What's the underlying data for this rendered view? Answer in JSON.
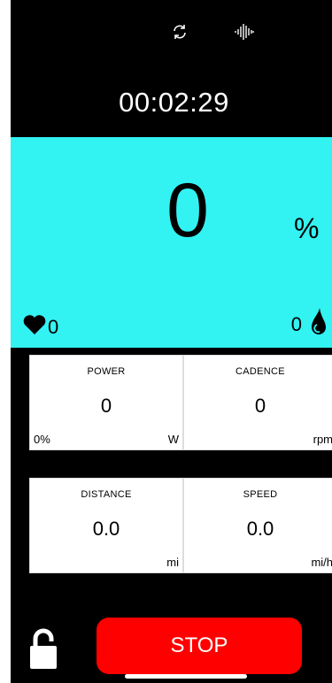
{
  "icons": {
    "sync": "sync-icon",
    "audio": "audio-wave-icon",
    "heart": "heart-icon",
    "drop": "drop-icon",
    "lock": "unlock-icon"
  },
  "timer": "00:02:29",
  "main_metric": {
    "value": "0",
    "unit": "%"
  },
  "heart_rate": "0",
  "sweat": "0",
  "cards": {
    "power": {
      "title": "POWER",
      "value": "0",
      "unit": "W",
      "percent": "0%"
    },
    "cadence": {
      "title": "CADENCE",
      "value": "0",
      "unit": "rpm"
    },
    "distance": {
      "title": "DISTANCE",
      "value": "0.0",
      "unit": "mi"
    },
    "speed": {
      "title": "SPEED",
      "value": "0.0",
      "unit": "mi/h"
    }
  },
  "stop_label": "STOP",
  "colors": {
    "metric_bg": "#33f2f2",
    "stop_bg": "#ff0000"
  }
}
